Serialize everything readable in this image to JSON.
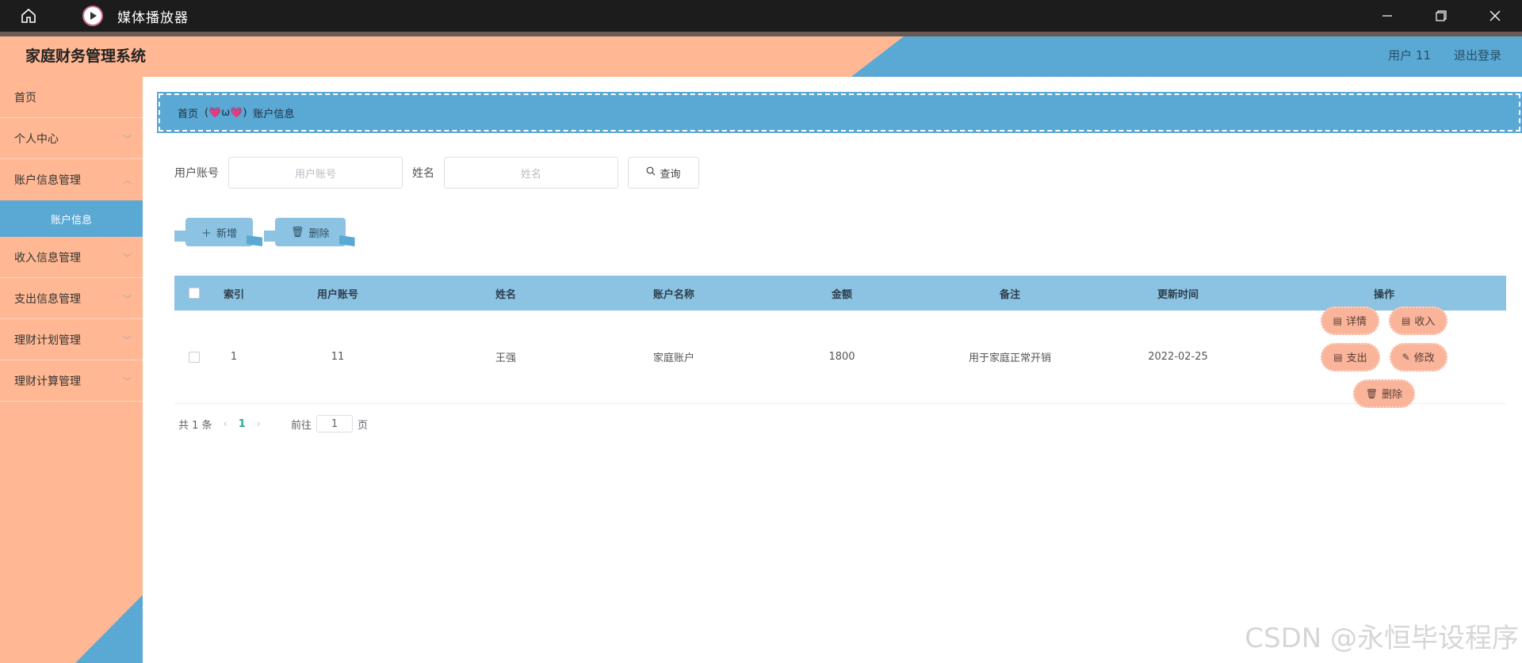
{
  "window": {
    "app_title": "媒体播放器"
  },
  "header": {
    "system_title": "家庭财务管理系统",
    "user": "用户 11",
    "logout": "退出登录"
  },
  "sidebar": {
    "items": [
      {
        "label": "首页",
        "expandable": false
      },
      {
        "label": "个人中心",
        "expandable": true
      },
      {
        "label": "账户信息管理",
        "expandable": true,
        "children": [
          "账户信息"
        ]
      },
      {
        "label": "收入信息管理",
        "expandable": true
      },
      {
        "label": "支出信息管理",
        "expandable": true
      },
      {
        "label": "理财计划管理",
        "expandable": true
      },
      {
        "label": "理财计算管理",
        "expandable": true
      }
    ]
  },
  "breadcrumb": {
    "home": "首页",
    "separator": "(💗ω💗)",
    "current": "账户信息"
  },
  "search": {
    "account_label": "用户账号",
    "account_placeholder": "用户账号",
    "name_label": "姓名",
    "name_placeholder": "姓名",
    "query_button": "查询"
  },
  "actions": {
    "add": "新增",
    "delete": "删除"
  },
  "table": {
    "headers": [
      "索引",
      "用户账号",
      "姓名",
      "账户名称",
      "金额",
      "备注",
      "更新时间",
      "操作"
    ],
    "rows": [
      {
        "index": "1",
        "account": "11",
        "name": "王强",
        "account_name": "家庭账户",
        "amount": "1800",
        "note": "用于家庭正常开销",
        "updated": "2022-02-25"
      }
    ],
    "row_ops": [
      "详情",
      "收入",
      "支出",
      "修改",
      "删除"
    ]
  },
  "pagination": {
    "total": "共 1 条",
    "current_page": "1",
    "goto_label": "前往",
    "goto_value": "1",
    "page_suffix": "页"
  },
  "watermark": "CSDN @永恒毕设程序",
  "colors": {
    "peach": "#ffb893",
    "blue": "#5aa8d4",
    "light_blue": "#8cc3e2",
    "op_button": "#f9b49a"
  }
}
